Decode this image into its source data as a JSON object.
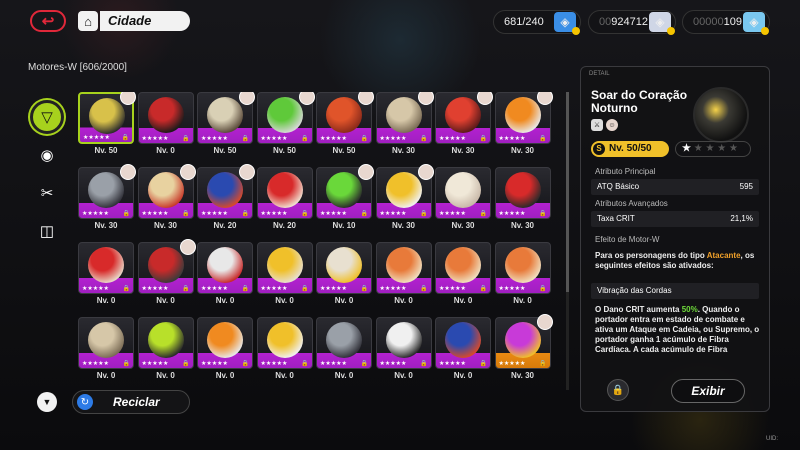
{
  "header": {
    "back_icon": "back-arrow-icon",
    "home_icon": "house-icon",
    "location": "Cidade",
    "resources": [
      {
        "value_dim": "",
        "value": "681/240",
        "icon": "battery-icon",
        "color": "#3a8ee6"
      },
      {
        "value_dim": "00",
        "value": "924712",
        "icon": "denny-coin-icon",
        "color": "#cfd6e6"
      },
      {
        "value_dim": "00000",
        "value": "109",
        "icon": "film-ticket-icon",
        "color": "#7ac8f0"
      }
    ]
  },
  "inventory": {
    "title": "Motores-W [606/2000]",
    "tabs": [
      "w-engine-tab-icon",
      "disc-tab-icon",
      "material-tab-icon",
      "bangboo-tab-icon"
    ],
    "cards": [
      {
        "lvl": "Nv. 50",
        "rarity": "S",
        "art": [
          "#d8c14a",
          "#2b2b2b"
        ],
        "avatar": true,
        "selected": true
      },
      {
        "lvl": "Nv. 0",
        "rarity": "S",
        "art": [
          "#c82a2a",
          "#1a1a1a"
        ],
        "avatar": false
      },
      {
        "lvl": "Nv. 50",
        "rarity": "S",
        "art": [
          "#d9d0b5",
          "#5a4a3a"
        ],
        "avatar": true
      },
      {
        "lvl": "Nv. 50",
        "rarity": "S",
        "art": [
          "#5fc93a",
          "#d8d8d8"
        ],
        "avatar": true
      },
      {
        "lvl": "Nv. 50",
        "rarity": "S",
        "art": [
          "#e0542a",
          "#8a2a1a"
        ],
        "avatar": true
      },
      {
        "lvl": "Nv. 30",
        "rarity": "S",
        "art": [
          "#d6c7a8",
          "#7a6b55"
        ],
        "avatar": true
      },
      {
        "lvl": "Nv. 30",
        "rarity": "S",
        "art": [
          "#e04030",
          "#5a1a1a"
        ],
        "avatar": true
      },
      {
        "lvl": "Nv. 30",
        "rarity": "S",
        "art": [
          "#f08a20",
          "#e8e8e8"
        ],
        "avatar": true
      },
      {
        "lvl": "Nv. 30",
        "rarity": "S",
        "art": [
          "#9aa0a8",
          "#303038"
        ],
        "avatar": true
      },
      {
        "lvl": "Nv. 30",
        "rarity": "S",
        "art": [
          "#e8d2a0",
          "#c83a2a"
        ],
        "avatar": true
      },
      {
        "lvl": "Nv. 20",
        "rarity": "S",
        "art": [
          "#2a4ab0",
          "#d84a2a"
        ],
        "avatar": true
      },
      {
        "lvl": "Nv. 20",
        "rarity": "S",
        "art": [
          "#d82a2a",
          "#f0e0d0"
        ],
        "avatar": false
      },
      {
        "lvl": "Nv. 10",
        "rarity": "S",
        "art": [
          "#6ad83a",
          "#2a2a2a"
        ],
        "avatar": true
      },
      {
        "lvl": "Nv. 30",
        "rarity": "S",
        "art": [
          "#f0c02a",
          "#f0f0f0"
        ],
        "avatar": true
      },
      {
        "lvl": "Nv. 30",
        "rarity": "S",
        "art": [
          "#f0e8d8",
          "#c8b8a8"
        ],
        "avatar": false
      },
      {
        "lvl": "Nv. 30",
        "rarity": "S",
        "art": [
          "#d82a2a",
          "#2a2a2a"
        ],
        "avatar": false
      },
      {
        "lvl": "Nv. 0",
        "rarity": "S",
        "art": [
          "#d82a2a",
          "#e8d8c8"
        ],
        "avatar": false
      },
      {
        "lvl": "Nv. 0",
        "rarity": "S",
        "art": [
          "#c82a2a",
          "#3a3a3a"
        ],
        "avatar": true
      },
      {
        "lvl": "Nv. 0",
        "rarity": "S",
        "art": [
          "#e8e8e8",
          "#c82a2a"
        ],
        "avatar": false
      },
      {
        "lvl": "Nv. 0",
        "rarity": "S",
        "art": [
          "#f0c02a",
          "#e8e0d0"
        ],
        "avatar": false
      },
      {
        "lvl": "Nv. 0",
        "rarity": "S",
        "art": [
          "#e8e0d0",
          "#f0c02a"
        ],
        "avatar": false
      },
      {
        "lvl": "Nv. 0",
        "rarity": "S",
        "art": [
          "#e87a3a",
          "#f0e0c0"
        ],
        "avatar": false
      },
      {
        "lvl": "Nv. 0",
        "rarity": "S",
        "art": [
          "#e87a3a",
          "#f0e0c0"
        ],
        "avatar": false
      },
      {
        "lvl": "Nv. 0",
        "rarity": "S",
        "art": [
          "#e87a3a",
          "#f0e0c0"
        ],
        "avatar": false
      },
      {
        "lvl": "Nv. 0",
        "rarity": "S",
        "art": [
          "#d6c7a8",
          "#7a6b55"
        ],
        "avatar": false
      },
      {
        "lvl": "Nv. 0",
        "rarity": "S",
        "art": [
          "#b8e02a",
          "#2a2a2a"
        ],
        "avatar": false
      },
      {
        "lvl": "Nv. 0",
        "rarity": "S",
        "art": [
          "#f08a20",
          "#e8e8e8"
        ],
        "avatar": false
      },
      {
        "lvl": "Nv. 0",
        "rarity": "S",
        "art": [
          "#f0c02a",
          "#f0f0f0"
        ],
        "avatar": false
      },
      {
        "lvl": "Nv. 0",
        "rarity": "S",
        "art": [
          "#9aa0a8",
          "#303038"
        ],
        "avatar": false
      },
      {
        "lvl": "Nv. 0",
        "rarity": "S",
        "art": [
          "#f0f0f0",
          "#2a2a2a"
        ],
        "avatar": false
      },
      {
        "lvl": "Nv. 0",
        "rarity": "S",
        "art": [
          "#2a4ab0",
          "#d84a2a"
        ],
        "avatar": false
      },
      {
        "lvl": "Nv. 30",
        "rarity": "A",
        "art": [
          "#c83ad8",
          "#f0c02a"
        ],
        "avatar": true
      }
    ],
    "filter_icon": "funnel-icon",
    "recycle_label": "Reciclar",
    "recycle_icon": "recycle-icon"
  },
  "detail": {
    "tag": "DETAIL",
    "name": "Soar do Coração Noturno",
    "level": "Nv. 50/50",
    "rank_filled": 1,
    "rank_total": 5,
    "main_attr_title": "Atributo Principal",
    "main_attr_name": "ATQ Básico",
    "main_attr_value": "595",
    "adv_attr_title": "Atributos Avançados",
    "adv_attr_name": "Taxa CRIT",
    "adv_attr_value": "21,1%",
    "effect_title": "Efeito de Motor-W",
    "effect_intro_a": "Para os personagens do tipo ",
    "effect_intro_type": "Atacante",
    "effect_intro_b": ", os seguintes efeitos são ativados:",
    "effect_name": "Vibração das Cordas",
    "effect_desc_a": "O Dano CRIT aumenta ",
    "effect_desc_pct": "50%",
    "effect_desc_b": ". Quando o portador entra em estado de combate e ativa um Ataque em Cadeia, ou Supremo, o portador ganha 1 acúmulo de Fibra Cardíaca. A cada acúmulo de Fibra",
    "show_label": "Exibir",
    "lock_icon": "lock-icon"
  },
  "footer": {
    "uid_label": "UID:"
  }
}
